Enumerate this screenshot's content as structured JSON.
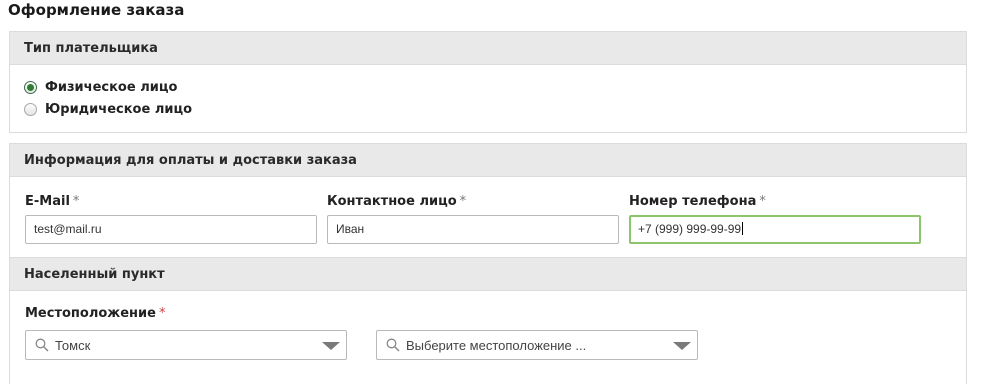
{
  "page": {
    "title": "Оформление заказа"
  },
  "payer_type": {
    "heading": "Тип плательщика",
    "options": [
      {
        "label": "Физическое лицо",
        "checked": true
      },
      {
        "label": "Юридическое лицо",
        "checked": false
      }
    ]
  },
  "info": {
    "heading": "Информация для оплаты и доставки заказа",
    "required_mark": "*",
    "fields": [
      {
        "label": "E-Mail",
        "value": "test@mail.ru"
      },
      {
        "label": "Контактное лицо",
        "value": "Иван"
      },
      {
        "label": "Номер телефона",
        "value": "+7 (999) 999-99-99"
      }
    ]
  },
  "location": {
    "heading": "Населенный пункт",
    "label": "Местоположение",
    "required_mark": "*",
    "city_value": "Томск",
    "place_placeholder": "Выберите местоположение ..."
  },
  "icons": {
    "search": "search-icon",
    "dropdown": "chevron-down-icon"
  },
  "colors": {
    "focus_border": "#8cc56a",
    "radio_checked": "#2f7d2f",
    "section_header_bg": "#e9e9e9"
  }
}
